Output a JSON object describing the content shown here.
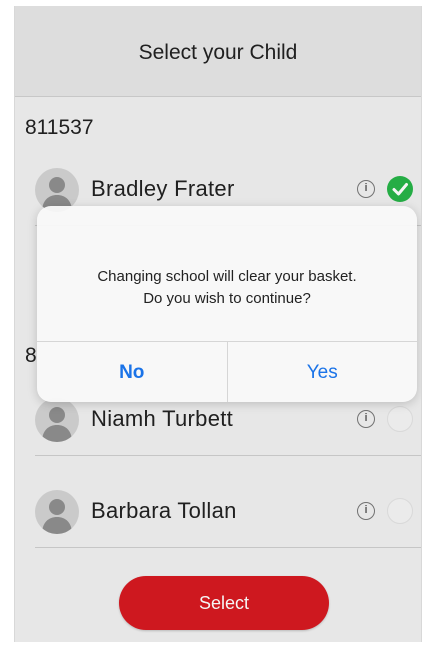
{
  "header": {
    "title": "Select your Child"
  },
  "schools": [
    {
      "code": "811537"
    },
    {
      "code": "8"
    }
  ],
  "children": [
    {
      "name": "Bradley Frater",
      "info_icon": "i",
      "selected": true
    },
    {
      "name": "Niamh Turbett",
      "info_icon": "i",
      "selected": false
    },
    {
      "name": "Barbara Tollan",
      "info_icon": "i",
      "selected": false
    }
  ],
  "dialog": {
    "message_line1": "Changing school will clear your basket.",
    "message_line2": "Do you wish to continue?",
    "no_label": "No",
    "yes_label": "Yes"
  },
  "footer": {
    "select_label": "Select"
  },
  "colors": {
    "accent_red": "#d71921",
    "check_green": "#27b548",
    "link_blue": "#1a73e8"
  }
}
